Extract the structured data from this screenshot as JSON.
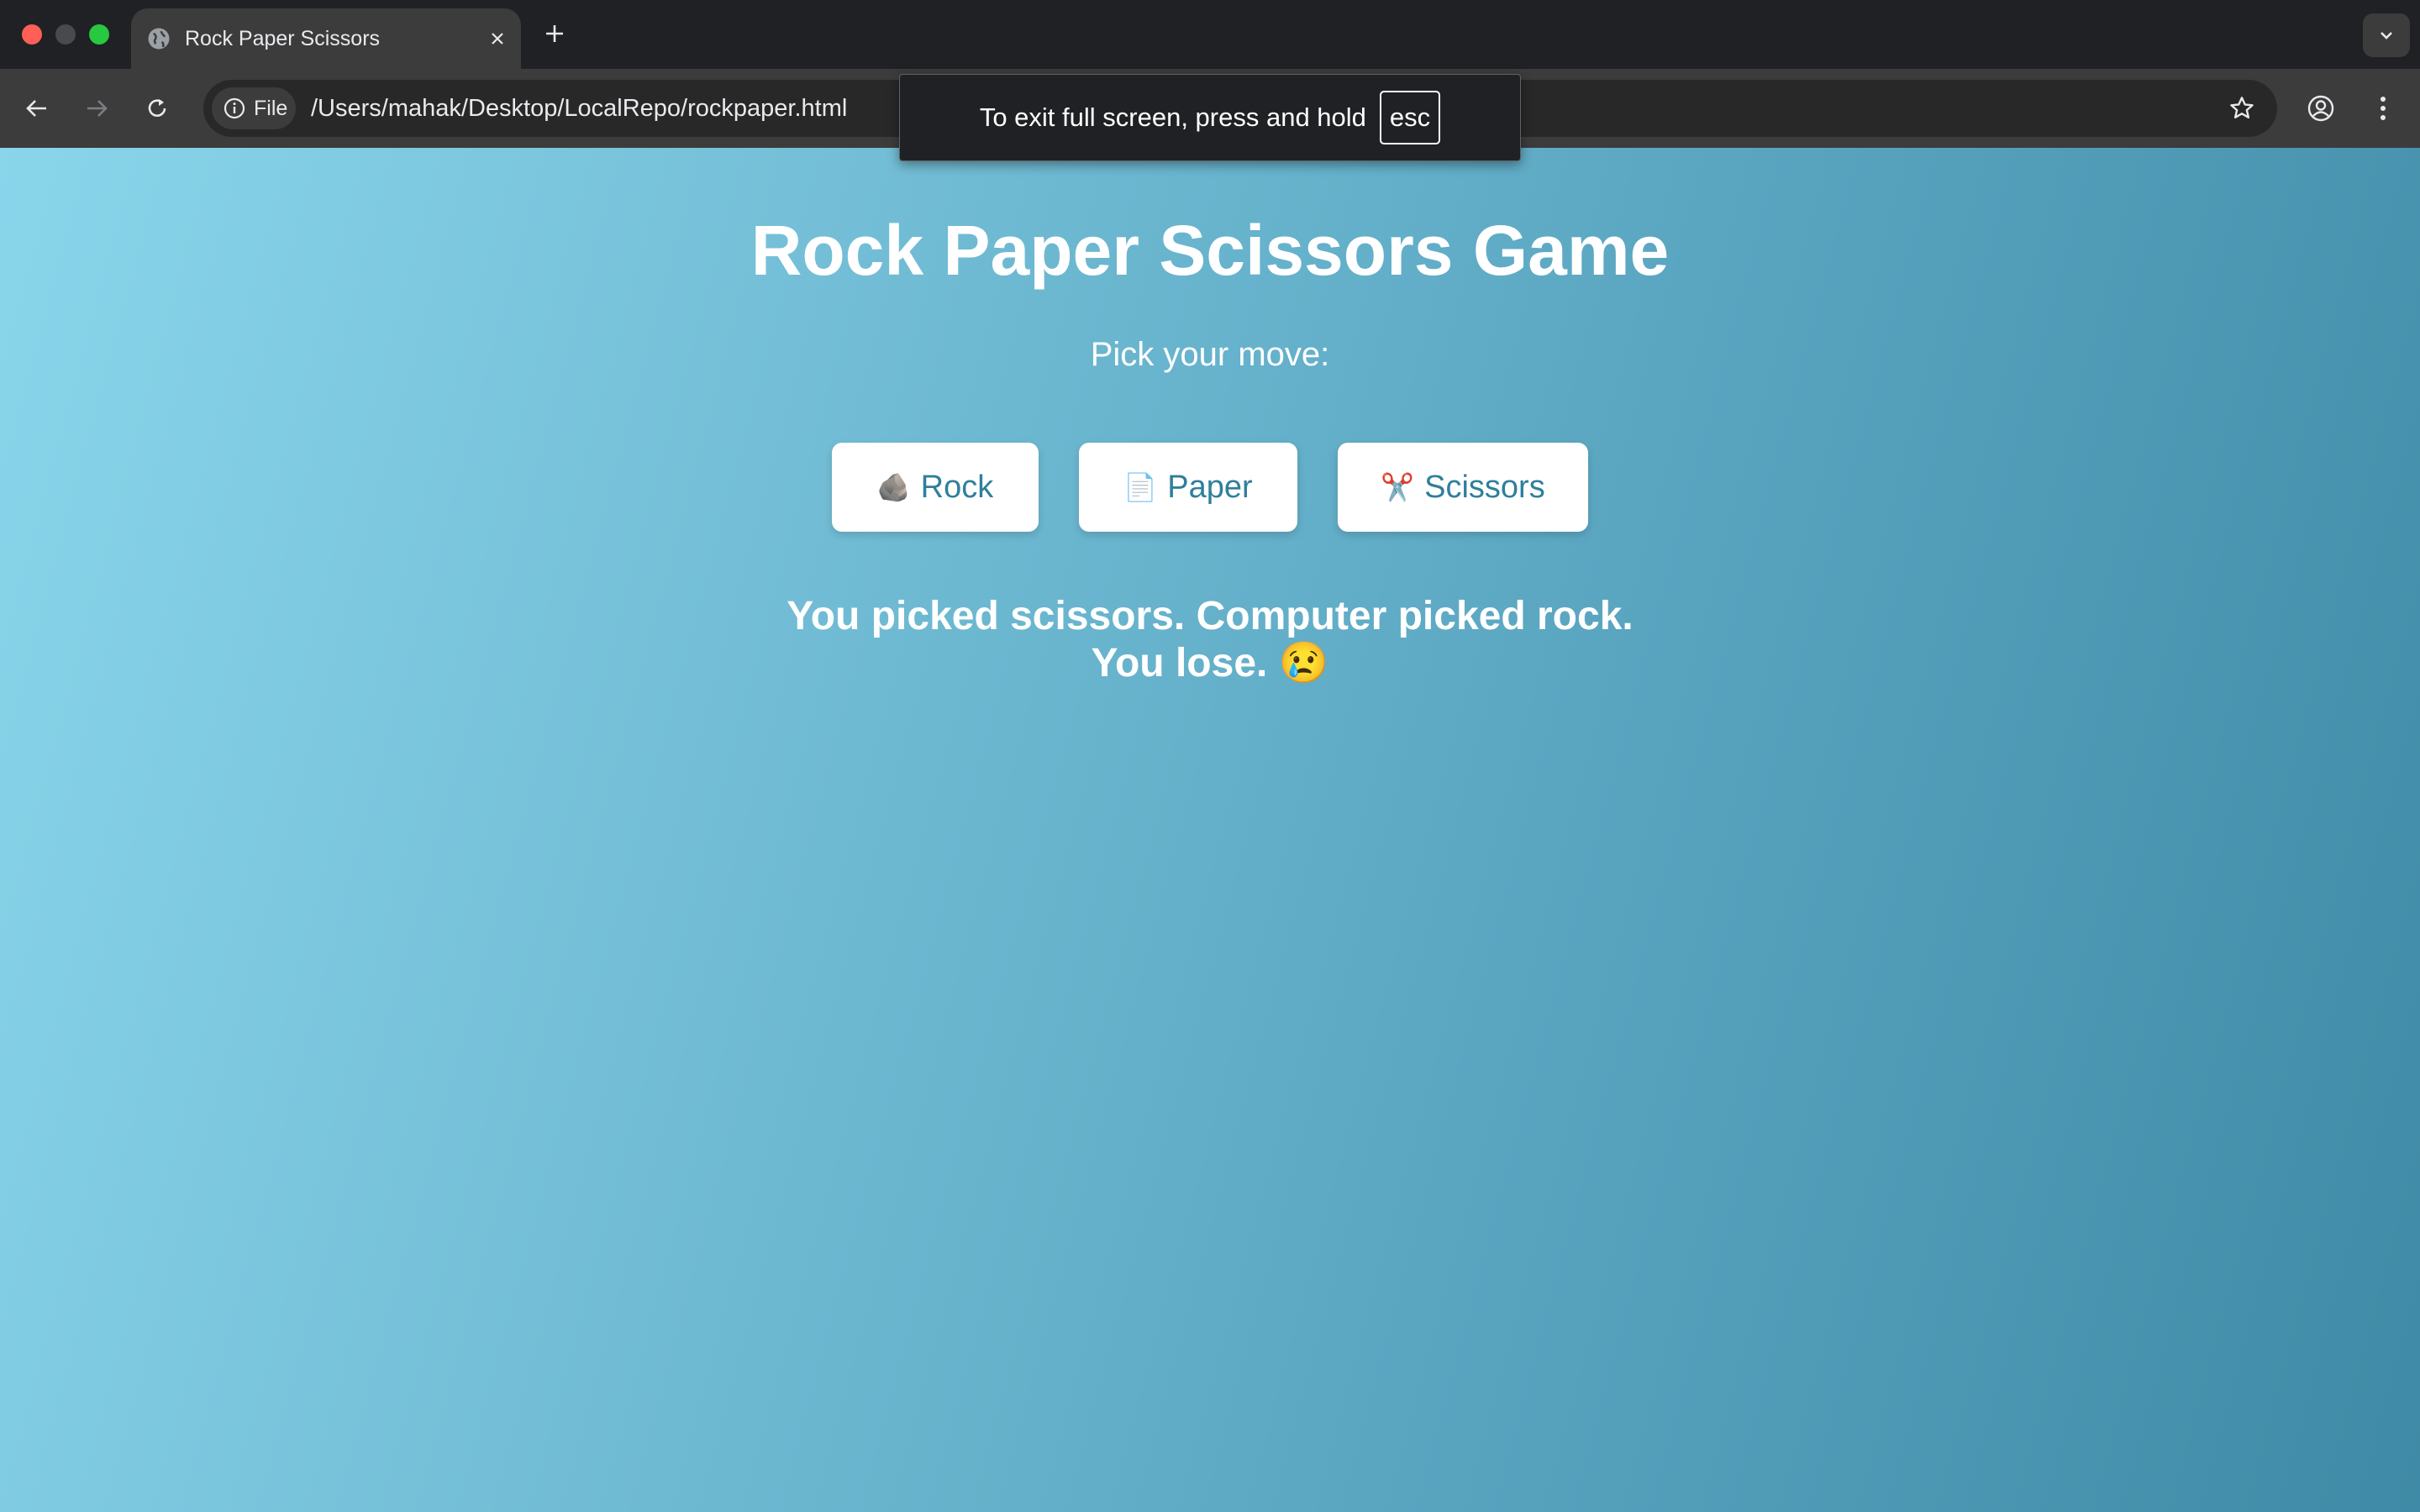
{
  "browser": {
    "tab_title": "Rock Paper Scissors",
    "chip_label": "File",
    "url": "/Users/mahak/Desktop/LocalRepo/rockpaper.html",
    "fullscreen_message": "To exit full screen, press and hold",
    "fullscreen_key": "esc",
    "icons": [
      "globe-icon",
      "close-icon",
      "plus-icon",
      "chevron-down-icon",
      "back-arrow-icon",
      "forward-arrow-icon",
      "reload-icon",
      "info-icon",
      "star-icon",
      "profile-icon",
      "more-vertical-icon"
    ]
  },
  "game": {
    "title": "Rock Paper Scissors Game",
    "prompt": "Pick your move:",
    "moves": [
      {
        "emoji": "🪨",
        "label": "Rock"
      },
      {
        "emoji": "📄",
        "label": "Paper"
      },
      {
        "emoji": "✂️",
        "label": "Scissors"
      }
    ],
    "result_line1": "You picked scissors. Computer picked rock.",
    "result_line2": "You lose. 😢"
  },
  "colors": {
    "gradient_start": "#89d5ea",
    "gradient_end": "#3f8aa6",
    "button_text": "#2f7f9c"
  }
}
